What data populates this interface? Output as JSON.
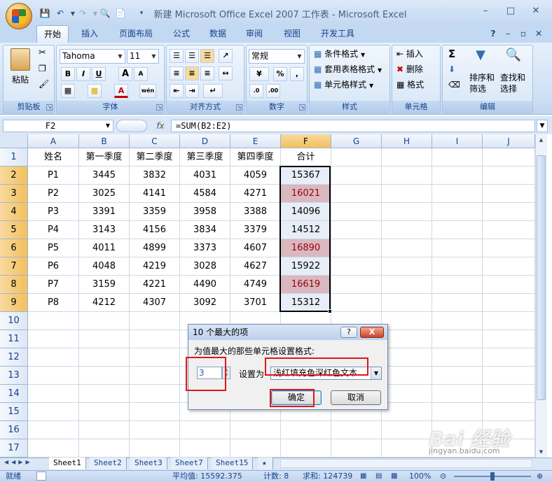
{
  "window": {
    "title": "新建 Microsoft Office Excel 2007 工作表 - Microsoft Excel"
  },
  "ribbon_tabs": [
    "开始",
    "插入",
    "页面布局",
    "公式",
    "数据",
    "审阅",
    "视图",
    "开发工具"
  ],
  "ribbon": {
    "clipboard": {
      "paste": "粘贴",
      "label": "剪贴板"
    },
    "font": {
      "name": "Tahoma",
      "size": "11",
      "label": "字体",
      "bold": "B",
      "italic": "I",
      "underline": "U",
      "grow": "A",
      "shrink": "A",
      "fontcolor": "A",
      "phonetic": "wén"
    },
    "alignment": {
      "label": "对齐方式"
    },
    "number": {
      "format": "常规",
      "percent": "%",
      "comma": ",",
      "label": "数字"
    },
    "styles": {
      "conditional": "条件格式",
      "table": "套用表格格式",
      "cell": "单元格样式",
      "label": "样式"
    },
    "cells": {
      "insert": "插入",
      "delete": "删除",
      "format": "格式",
      "label": "单元格"
    },
    "editing": {
      "sum": "Σ",
      "sortfilter": "排序和\n筛选",
      "sort_line1": "排序和",
      "sort_line2": "筛选",
      "find_line1": "查找和",
      "find_line2": "选择",
      "label": "编辑"
    }
  },
  "formula_bar": {
    "name_box": "F2",
    "fx": "fx",
    "formula": "=SUM(B2:E2)"
  },
  "columns": [
    "A",
    "B",
    "C",
    "D",
    "E",
    "F",
    "G",
    "H",
    "I",
    "J"
  ],
  "rows": [
    "1",
    "2",
    "3",
    "4",
    "5",
    "6",
    "7",
    "8",
    "9",
    "10",
    "11",
    "12",
    "13",
    "14",
    "15",
    "16",
    "17"
  ],
  "table": {
    "headers": [
      "姓名",
      "第一季度",
      "第二季度",
      "第三季度",
      "第四季度",
      "合计"
    ],
    "data": [
      [
        "P1",
        "3445",
        "3832",
        "4031",
        "4059",
        "15367"
      ],
      [
        "P2",
        "3025",
        "4141",
        "4584",
        "4271",
        "16021"
      ],
      [
        "P3",
        "3391",
        "3359",
        "3958",
        "3388",
        "14096"
      ],
      [
        "P4",
        "3143",
        "4156",
        "3834",
        "3379",
        "14512"
      ],
      [
        "P5",
        "4011",
        "4899",
        "3373",
        "4607",
        "16890"
      ],
      [
        "P6",
        "4048",
        "4219",
        "3028",
        "4627",
        "15922"
      ],
      [
        "P7",
        "3159",
        "4221",
        "4490",
        "4749",
        "16619"
      ],
      [
        "P8",
        "4212",
        "4307",
        "3092",
        "3701",
        "15312"
      ]
    ],
    "highlighted_rows": [
      1,
      4,
      6
    ],
    "highlight_fill": "#d9b8c0",
    "highlight_text": "#9c0006"
  },
  "sheet_tabs": [
    "Sheet1",
    "Sheet2",
    "Sheet3",
    "Sheet7",
    "Sheet15"
  ],
  "status": {
    "mode": "就绪",
    "average": "平均值: 15592.375",
    "count": "计数: 8",
    "sum": "求和: 124739",
    "zoom": "100%"
  },
  "dialog": {
    "title": "10 个最大的项",
    "help": "?",
    "close": "X",
    "description": "为值最大的那些单元格设置格式:",
    "count_value": "3",
    "set_label": "设置为",
    "format_value": "浅红填充色深红色文本",
    "ok": "确定",
    "cancel": "取消"
  },
  "watermark": {
    "text": "Bai 经验",
    "url": "jingyan.baidu.com"
  }
}
